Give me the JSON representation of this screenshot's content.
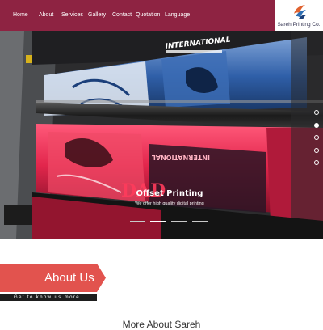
{
  "nav": {
    "items": [
      {
        "label": "Home"
      },
      {
        "label": "About"
      },
      {
        "label": "Services"
      },
      {
        "label": "Gallery"
      },
      {
        "label": "Contact"
      },
      {
        "label": "Quotation"
      },
      {
        "label": "Language"
      }
    ]
  },
  "logo": {
    "text": "Sareh Printing Co.",
    "icon": "bird-logo-icon"
  },
  "hero": {
    "title": "Offset Printing",
    "subtitle": "We offer high quality digital printing",
    "active_slide": 2,
    "slide_count": 4,
    "dot_count": 5,
    "active_dot": 2
  },
  "about": {
    "title": "About Us",
    "tagline": "Get to know us more",
    "more_heading": "More About Sareh"
  },
  "colors": {
    "brand": "#8e2342",
    "banner": "#e2534e",
    "tag_bg": "#1e1e1e"
  }
}
